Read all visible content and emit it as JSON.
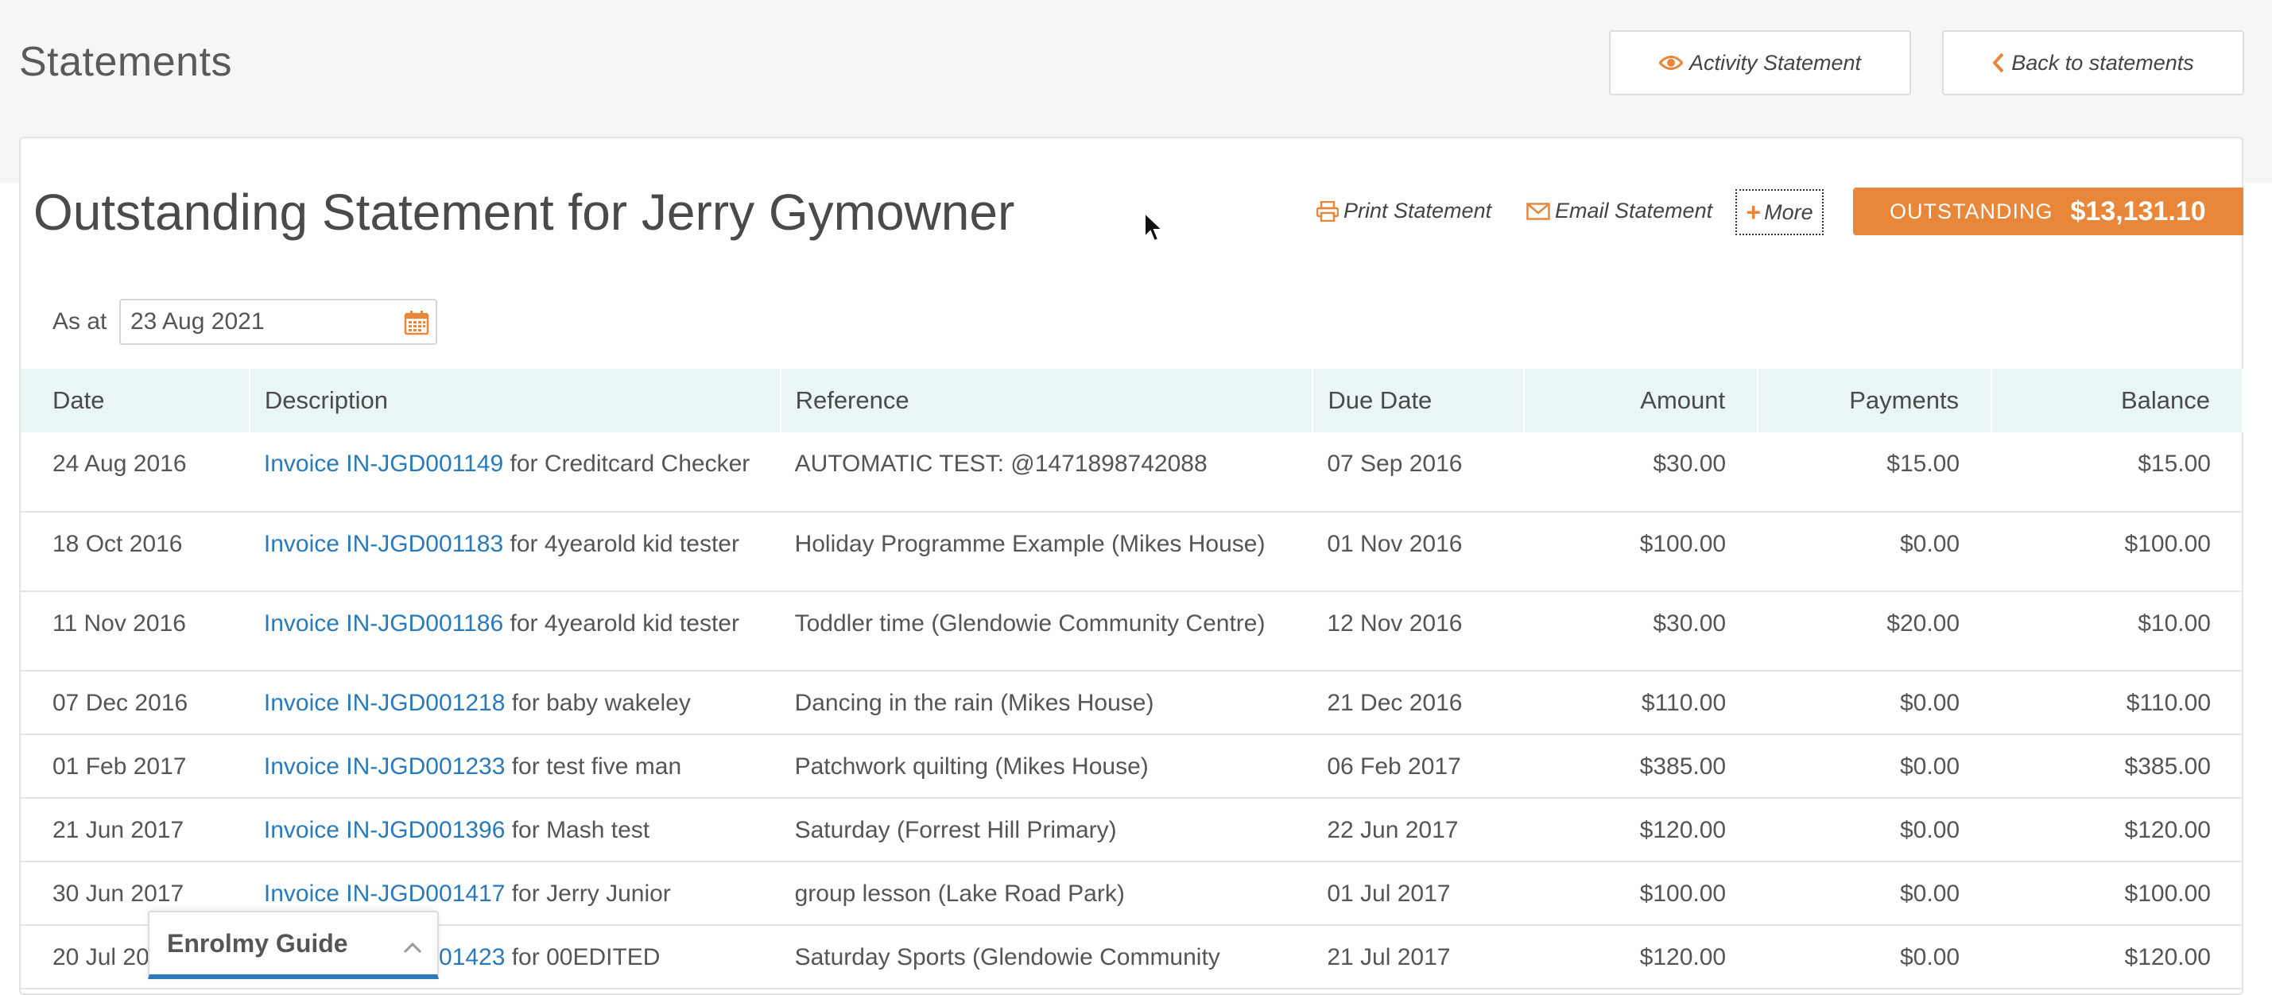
{
  "header": {
    "title": "Statements",
    "activity_btn": "Activity Statement",
    "back_btn": "Back to statements"
  },
  "statement": {
    "title": "Outstanding Statement for Jerry Gymowner",
    "print": "Print Statement",
    "email": "Email Statement",
    "more": "More",
    "outstanding_label": "OUTSTANDING",
    "outstanding_amount": "$13,131.10",
    "asat_label": "As at",
    "asat_value": "23 Aug 2021"
  },
  "table": {
    "headers": [
      "Date",
      "Description",
      "Reference",
      "Due Date",
      "Amount",
      "Payments",
      "Balance"
    ],
    "rows": [
      {
        "date": "24 Aug 2016",
        "invoice": "Invoice IN-JGD001149",
        "desc": " for Creditcard Checker",
        "ref": "AUTOMATIC TEST: @1471898742088",
        "due": "07 Sep 2016",
        "amount": "$30.00",
        "payments": "$15.00",
        "balance": "$15.00"
      },
      {
        "date": "18 Oct 2016",
        "invoice": "Invoice IN-JGD001183",
        "desc": " for 4yearold kid tester",
        "ref": "Holiday Programme Example (Mikes House)",
        "due": "01 Nov 2016",
        "amount": "$100.00",
        "payments": "$0.00",
        "balance": "$100.00"
      },
      {
        "date": "11 Nov 2016",
        "invoice": "Invoice IN-JGD001186",
        "desc": " for 4yearold kid tester",
        "ref": "Toddler time (Glendowie Community Centre)",
        "due": "12 Nov 2016",
        "amount": "$30.00",
        "payments": "$20.00",
        "balance": "$10.00"
      },
      {
        "date": "07 Dec 2016",
        "invoice": "Invoice IN-JGD001218",
        "desc": " for baby wakeley",
        "ref": "Dancing in the rain (Mikes House)",
        "due": "21 Dec 2016",
        "amount": "$110.00",
        "payments": "$0.00",
        "balance": "$110.00"
      },
      {
        "date": "01 Feb 2017",
        "invoice": "Invoice IN-JGD001233",
        "desc": " for test five man",
        "ref": "Patchwork quilting (Mikes House)",
        "due": "06 Feb 2017",
        "amount": "$385.00",
        "payments": "$0.00",
        "balance": "$385.00"
      },
      {
        "date": "21 Jun 2017",
        "invoice": "Invoice IN-JGD001396",
        "desc": " for Mash test",
        "ref": "Saturday (Forrest Hill Primary)",
        "due": "22 Jun 2017",
        "amount": "$120.00",
        "payments": "$0.00",
        "balance": "$120.00"
      },
      {
        "date": "30 Jun 2017",
        "invoice": "Invoice IN-JGD001417",
        "desc": " for Jerry Junior",
        "ref": "group lesson (Lake Road Park)",
        "due": "01 Jul 2017",
        "amount": "$100.00",
        "payments": "$0.00",
        "balance": "$100.00"
      },
      {
        "date": "20 Jul 2017",
        "invoice": "Invoice IN-JGD001423",
        "desc": " for 00EDITED",
        "ref": "Saturday Sports (Glendowie Community",
        "due": "21 Jul 2017",
        "amount": "$120.00",
        "payments": "$0.00",
        "balance": "$120.00"
      }
    ]
  },
  "guide": {
    "label": "Enrolmy Guide"
  },
  "icons": {
    "eye": "eye-icon",
    "back": "chevron-left-icon",
    "print": "print-icon",
    "email": "envelope-icon",
    "more": "plus-icon",
    "calendar": "calendar-icon",
    "guide": "chevron-up-icon"
  },
  "colors": {
    "accent": "#e8873a",
    "link": "#2a7ab9",
    "header_bg": "#eaf6f6"
  }
}
